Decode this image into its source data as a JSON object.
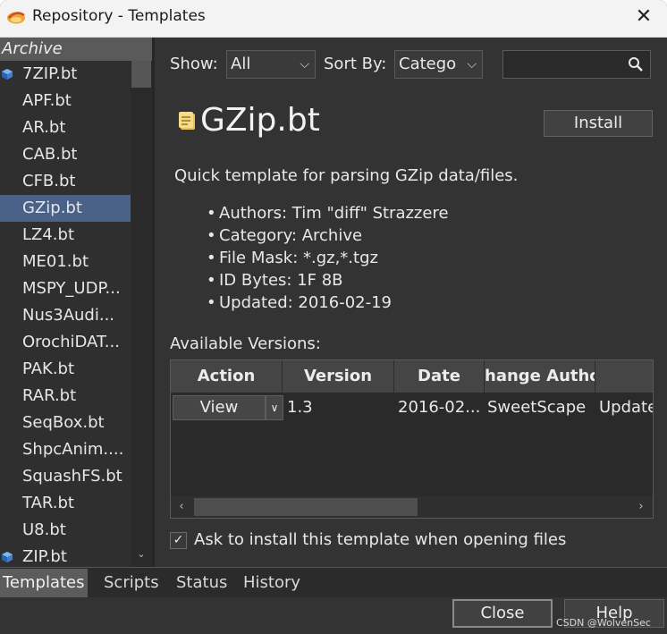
{
  "window": {
    "title": "Repository - Templates",
    "close_glyph": "✕"
  },
  "sidebar": {
    "category": "Archive",
    "items": [
      {
        "label": "7ZIP.bt",
        "icon": "cube-icon"
      },
      {
        "label": "APF.bt"
      },
      {
        "label": "AR.bt"
      },
      {
        "label": "CAB.bt"
      },
      {
        "label": "CFB.bt"
      },
      {
        "label": "GZip.bt",
        "selected": true
      },
      {
        "label": "LZ4.bt"
      },
      {
        "label": "ME01.bt"
      },
      {
        "label": "MSPY_UDP..."
      },
      {
        "label": "Nus3Audi..."
      },
      {
        "label": "OrochiDAT..."
      },
      {
        "label": "PAK.bt"
      },
      {
        "label": "RAR.bt"
      },
      {
        "label": "SeqBox.bt"
      },
      {
        "label": "ShpcAnim...."
      },
      {
        "label": "SquashFS.bt"
      },
      {
        "label": "TAR.bt"
      },
      {
        "label": "U8.bt"
      },
      {
        "label": "ZIP.bt",
        "icon": "cube-icon"
      }
    ]
  },
  "filters": {
    "show_label": "Show:",
    "show_value": "All",
    "sort_label": "Sort By:",
    "sort_value": "Catego",
    "search_value": ""
  },
  "template": {
    "name": "GZip.bt",
    "install_label": "Install",
    "description": "Quick template for parsing GZip data/files.",
    "details": [
      "Authors: Tim \"diff\" Strazzere",
      "Category: Archive",
      "File Mask: *.gz,*.tgz",
      "ID Bytes: 1F 8B",
      "Updated: 2016-02-19"
    ]
  },
  "versions": {
    "label": "Available Versions:",
    "columns": [
      "Action",
      "Version",
      "Date",
      "hange Autho"
    ],
    "rows": [
      {
        "action": "View",
        "version": "1.3",
        "date": "2016-02...",
        "author": "SweetScape",
        "notes": "Update"
      }
    ]
  },
  "ask_install": {
    "checked": true,
    "check_glyph": "✓",
    "label": "Ask to install this template when opening files"
  },
  "tabs": [
    "Templates",
    "Scripts",
    "Status",
    "History"
  ],
  "active_tab": "Templates",
  "buttons": {
    "close": "Close",
    "help": "Help"
  },
  "watermark": "CSDN @WolvenSec",
  "colors": {
    "selection": "#4a6287",
    "background": "#333333"
  }
}
